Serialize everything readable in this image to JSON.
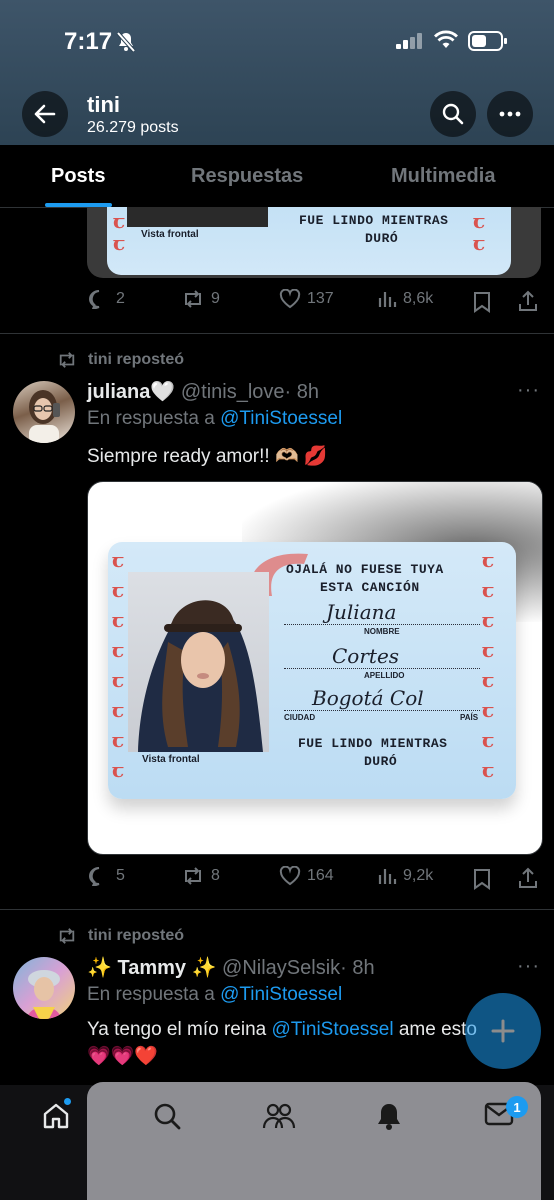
{
  "status": {
    "time": "7:17"
  },
  "header": {
    "name": "tini",
    "post_count": "26.279 posts"
  },
  "tabs": [
    {
      "label": "Posts"
    },
    {
      "label": "Respuestas"
    },
    {
      "label": "Multimedia"
    }
  ],
  "card_text": {
    "heading1": "OJALÁ NO FUESE TUYA",
    "heading2": "ESTA CANCIÓN",
    "nombre_label": "NOMBRE",
    "apellido_label": "APELLIDO",
    "ciudad_label": "CIUDAD",
    "pais_label": "PAÍS",
    "footer1": "FUE LINDO MIENTRAS",
    "footer2": "DURÓ",
    "vista": "Vista frontal"
  },
  "posts": [
    {
      "stats": {
        "replies": "2",
        "reposts": "9",
        "likes": "137",
        "views": "8,6k"
      }
    },
    {
      "repost_label": "tini reposteó",
      "name": "juliana🤍",
      "handle": "@tinis_love",
      "time": "· 8h",
      "reply_prefix": "En respuesta a",
      "reply_to": "@TiniStoessel",
      "text": "Siempre ready amor!! 🫶🏼 💋",
      "card": {
        "nombre": "Juliana",
        "apellido": "Cortes",
        "ciudad": "Bogotá Col"
      },
      "stats": {
        "replies": "5",
        "reposts": "8",
        "likes": "164",
        "views": "9,2k"
      }
    },
    {
      "repost_label": "tini reposteó",
      "name": "✨ Tammy ✨",
      "handle": "@NilaySelsik",
      "time": "· 8h",
      "reply_prefix": "En respuesta a",
      "reply_to": "@TiniStoessel",
      "text_before": "Ya tengo el mío reina",
      "text_mention": "@TiniStoessel",
      "text_after": "ame esto",
      "hearts": "💗💗❤️"
    }
  ],
  "notifications_badge": "1",
  "colors": {
    "accent": "#1d9bf0",
    "header_bg": "#3e5569",
    "muted": "#71767b"
  }
}
